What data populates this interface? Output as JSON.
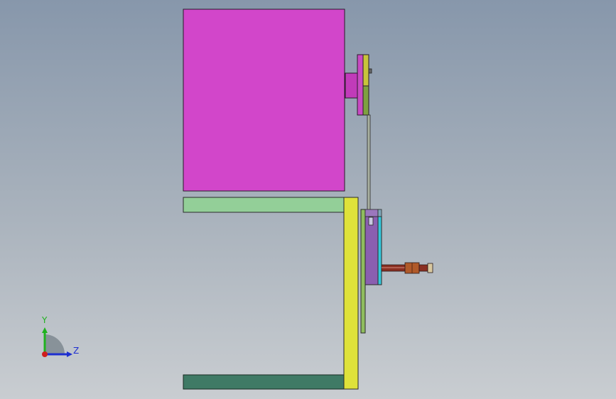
{
  "viewport": {
    "background_top": "#8797ab",
    "background_bottom": "#c9cdd1"
  },
  "triad": {
    "y_label": "Y",
    "z_label": "Z",
    "y_color": "#1fb21f",
    "z_color": "#1e2fd0",
    "x_color": "#d01e1e"
  },
  "parts": {
    "motor_color": "#d246ca",
    "upper_arm_color": "#93cf98",
    "lower_arm_color": "#3f7a65",
    "upright_color": "#dfe23a",
    "plate_color": "#8fbd5e",
    "block_color": "#8a5fb0",
    "cyan_plate_color": "#35c7da",
    "shaft_color": "#8a2f22",
    "collar_color": "#b05a2a"
  }
}
